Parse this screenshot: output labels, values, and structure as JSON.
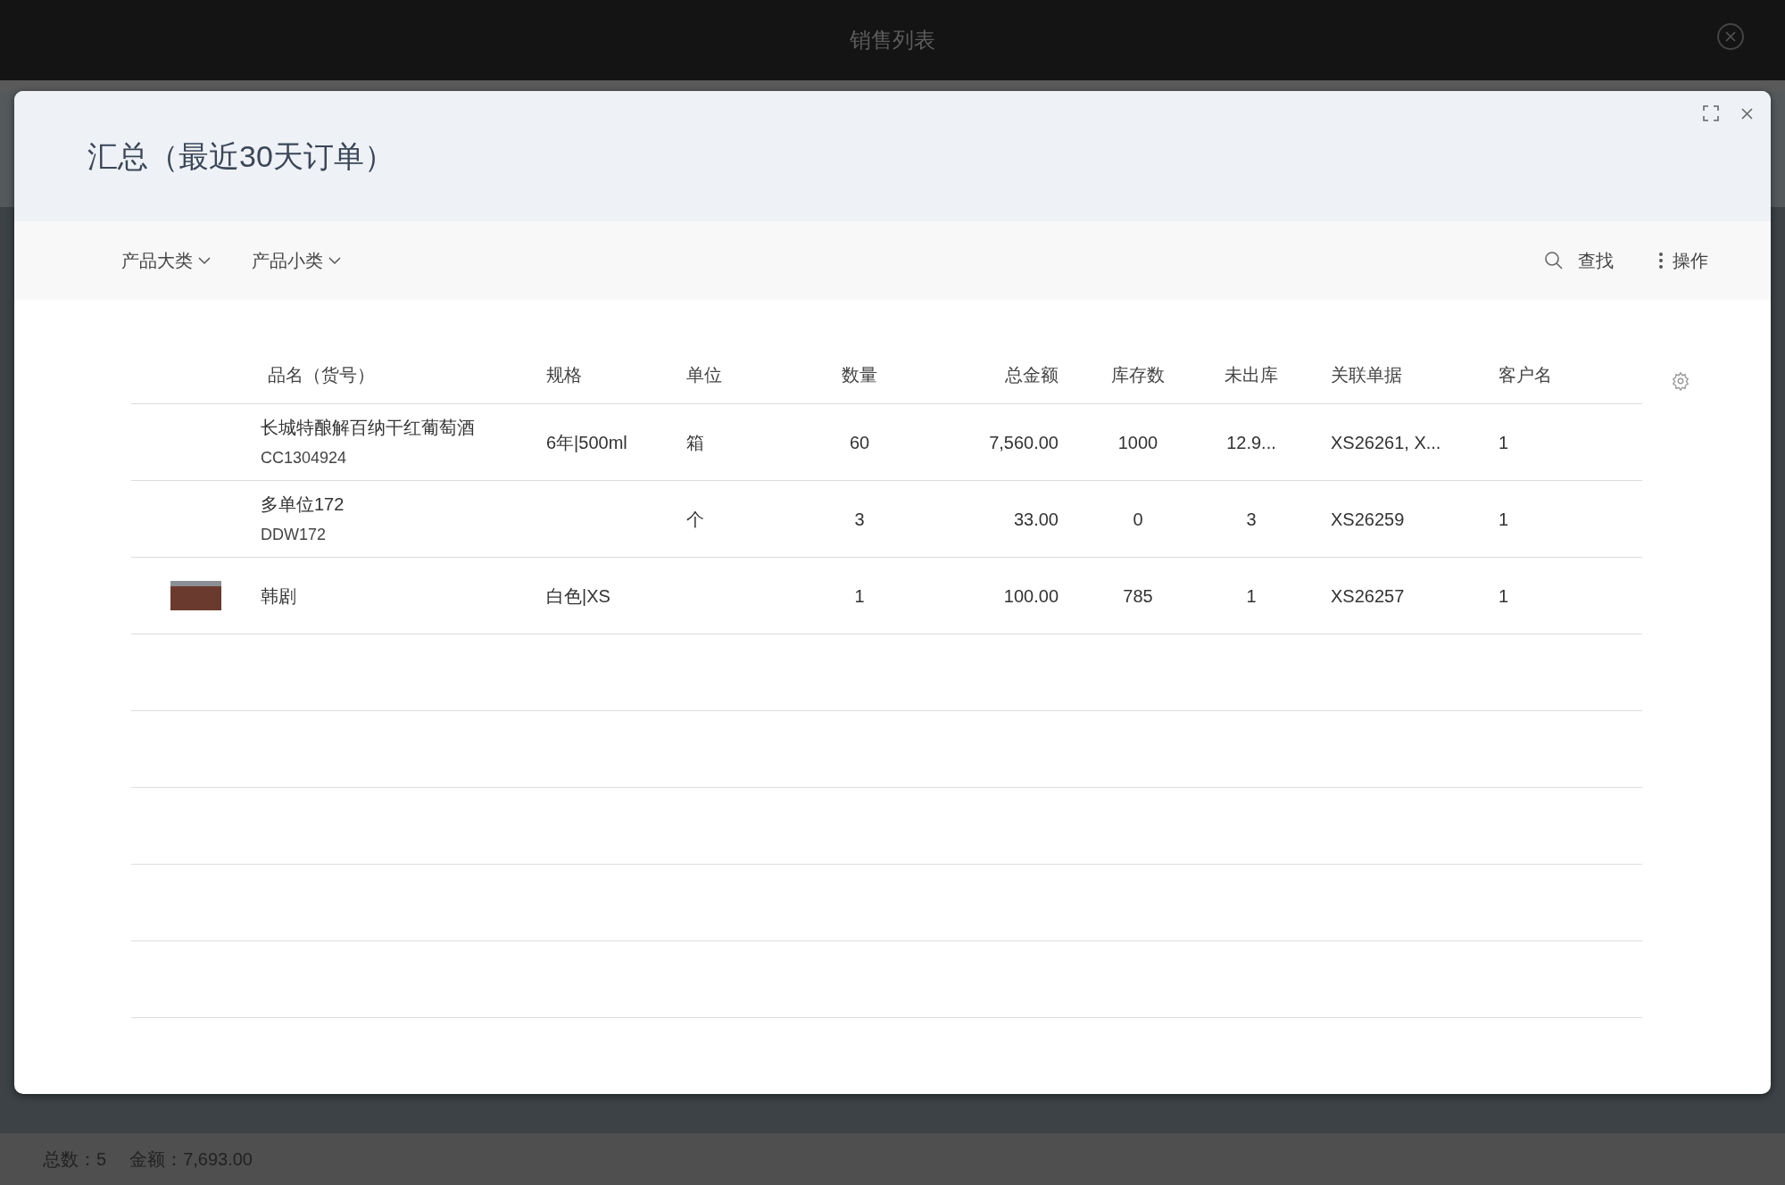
{
  "window": {
    "title": "销售列表"
  },
  "dialog": {
    "title": "汇总（最近30天订单）"
  },
  "toolbar": {
    "filters": [
      {
        "label": "产品大类"
      },
      {
        "label": "产品小类"
      }
    ],
    "actions": [
      {
        "kind": "search",
        "label": "查找"
      },
      {
        "kind": "more",
        "label": "操作"
      }
    ]
  },
  "table": {
    "columns": [
      {
        "label": "品名（货号）"
      },
      {
        "label": "规格"
      },
      {
        "label": "单位"
      },
      {
        "label": "数量"
      },
      {
        "label": "总金额"
      },
      {
        "label": "库存数"
      },
      {
        "label": "未出库"
      },
      {
        "label": "关联单据"
      },
      {
        "label": "客户名"
      }
    ],
    "rows": [
      {
        "has_image": false,
        "code": "CC1304924",
        "cells": [
          "长城特酿解百纳干红葡萄酒",
          "6年|500ml",
          "箱",
          "60",
          "7,560.00",
          "1000",
          "12.9...",
          "XS26261, X...",
          "1"
        ]
      },
      {
        "has_image": false,
        "code": "DDW172",
        "cells": [
          "多单位172",
          "",
          "个",
          "3",
          "33.00",
          "0",
          "3",
          "XS26259",
          "1"
        ]
      },
      {
        "has_image": true,
        "cells": [
          "韩剧",
          "白色|XS",
          "",
          "1",
          "100.00",
          "785",
          "1",
          "XS26257",
          "1"
        ]
      }
    ]
  },
  "status_bar": {
    "items": [
      "总数：5",
      "金额：7,693.00"
    ]
  }
}
